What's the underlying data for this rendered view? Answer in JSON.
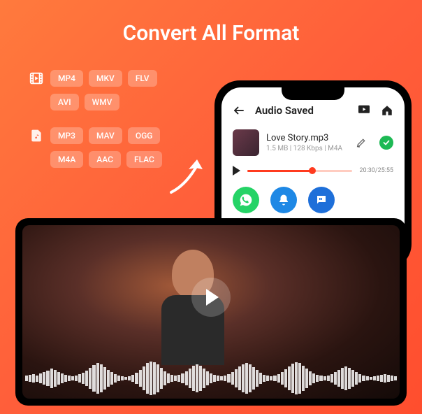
{
  "title": "Convert All Format",
  "video_formats": [
    "MP4",
    "MKV",
    "FLV",
    "AVI",
    "WMV"
  ],
  "audio_formats": [
    "MP3",
    "MAV",
    "OGG",
    "M4A",
    "AAC",
    "FLAC"
  ],
  "phone": {
    "back_icon": "back-arrow",
    "header_title": "Audio Saved",
    "save_icon": "save-storage",
    "home_icon": "home",
    "file": {
      "name": "Love Story.mp3",
      "meta": "1.5 MB | 128 Kbps | M4A",
      "edit_icon": "pencil-edit",
      "check_icon": "check"
    },
    "player": {
      "position_pct": 62,
      "time_display": "20:30/25:55"
    },
    "actions": {
      "whatsapp": "whatsapp-icon",
      "notify": "bell-icon",
      "message": "message-icon"
    }
  },
  "video_player": {
    "play_icon": "play",
    "waveform": "audio-waveform"
  }
}
